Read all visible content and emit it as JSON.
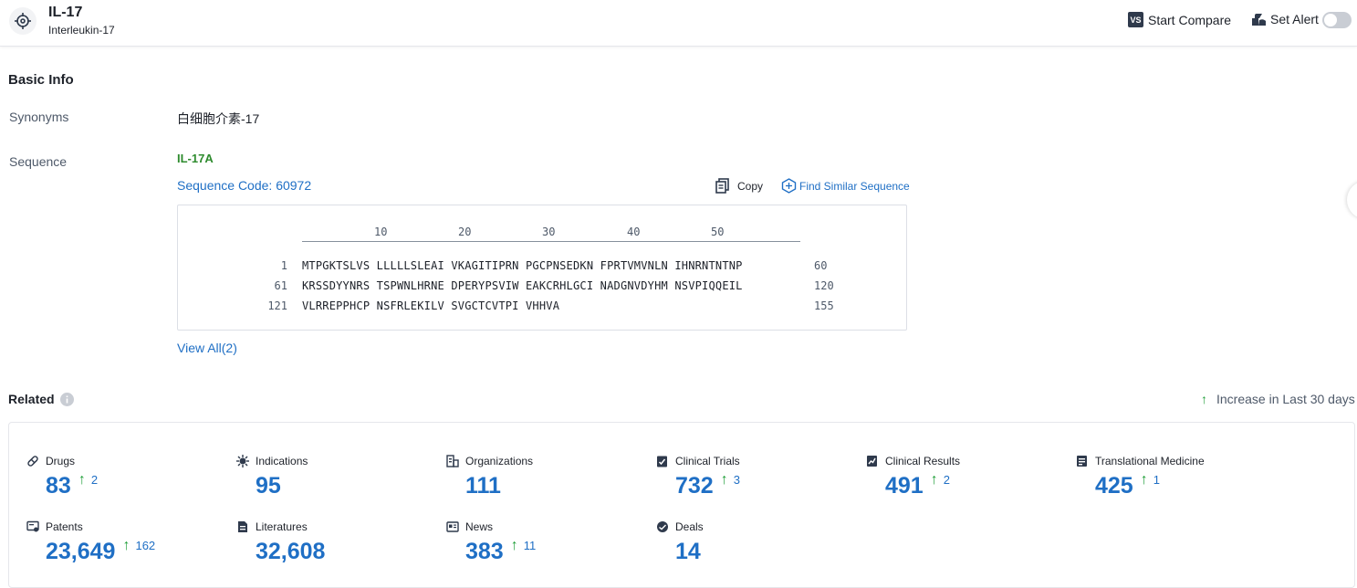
{
  "header": {
    "title": "IL-17",
    "subtitle": "Interleukin-17",
    "compare_icon_text": "VS",
    "compare_label": "Start Compare",
    "alert_label": "Set Alert"
  },
  "basic_info": {
    "heading": "Basic Info",
    "synonyms_label": "Synonyms",
    "synonyms_value": "白细胞介素-17",
    "sequence_label": "Sequence",
    "sequence_name": "IL-17A",
    "sequence_code": "Sequence Code: 60972",
    "copy_label": "Copy",
    "find_similar_label": "Find Similar Sequence",
    "view_all": "View All(2)",
    "ruler": [
      "10",
      "20",
      "30",
      "40",
      "50"
    ],
    "rows": [
      {
        "start": "1",
        "seq": "MTPGKTSLVS LLLLLSLEAI VKAGITIPRN PGCPNSEDKN FPRTVMVNLN IHNRNTNTNP",
        "end": "60"
      },
      {
        "start": "61",
        "seq": "KRSSDYYNRS TSPWNLHRNE DPERYPSVIW EAKCRHLGCI NADGNVDYHM NSVPIQQEIL",
        "end": "120"
      },
      {
        "start": "121",
        "seq": "VLRREPPHCP NSFRLEKILV SVGCTCVTPI VHHVA",
        "end": "155"
      }
    ]
  },
  "related": {
    "heading": "Related",
    "legend": "Increase in Last 30 days",
    "arrow": "↑",
    "stats": [
      {
        "label": "Drugs",
        "value": "83",
        "inc": "2",
        "icon": "pill-icon"
      },
      {
        "label": "Indications",
        "value": "95",
        "inc": "",
        "icon": "virus-icon"
      },
      {
        "label": "Organizations",
        "value": "111",
        "inc": "",
        "icon": "building-icon"
      },
      {
        "label": "Clinical Trials",
        "value": "732",
        "inc": "3",
        "icon": "clipboard-icon"
      },
      {
        "label": "Clinical Results",
        "value": "491",
        "inc": "2",
        "icon": "chart-doc-icon"
      },
      {
        "label": "Translational Medicine",
        "value": "425",
        "inc": "1",
        "icon": "flask-doc-icon"
      },
      {
        "label": "Patents",
        "value": "23,649",
        "inc": "162",
        "icon": "certificate-icon"
      },
      {
        "label": "Literatures",
        "value": "32,608",
        "inc": "",
        "icon": "document-icon"
      },
      {
        "label": "News",
        "value": "383",
        "inc": "11",
        "icon": "newspaper-icon"
      },
      {
        "label": "Deals",
        "value": "14",
        "inc": "",
        "icon": "handshake-icon"
      }
    ]
  },
  "colors": {
    "accent_blue": "#1f6fc5",
    "increase_green": "#23a03c",
    "sequence_green": "#2e8b2e"
  }
}
